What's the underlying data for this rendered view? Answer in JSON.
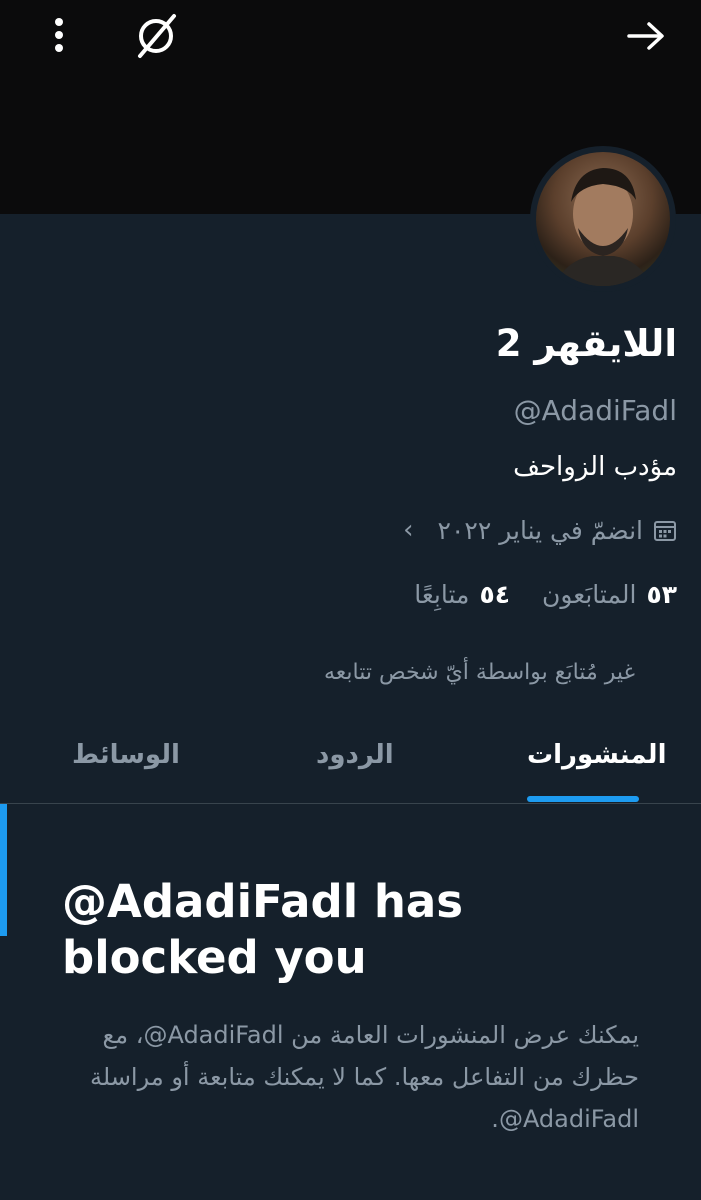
{
  "topbar": {
    "menu_icon": "kebab-vertical-icon",
    "logo_icon": "slashed-circle-icon",
    "nav_icon": "arrow-right-icon"
  },
  "profile": {
    "display_name": "اللايقهر 2",
    "handle": "@AdadiFadl",
    "bio": "مؤدب الزواحف",
    "joined": "انضمّ في يناير ٢٠٢٢",
    "joined_icon": "calendar-icon",
    "followers_count": "٥٣",
    "followers_label": "المتابَعون",
    "following_count": "٥٤",
    "following_label": "متابِعًا",
    "not_followed_note": "غير مُتابَع بواسطة أيّ شخص تتابعه"
  },
  "tabs": [
    {
      "label": "المنشورات",
      "active": true
    },
    {
      "label": "الردود",
      "active": false
    },
    {
      "label": "الوسائط",
      "active": false
    }
  ],
  "blocked": {
    "title": "@AdadiFadl has blocked you",
    "description": "يمكنك عرض المنشورات العامة من ‎@AdadiFadl‏، مع حظرك من التفاعل معها. كما لا يمكنك متابعة أو مراسلة ‎@AdadiFadl‏."
  },
  "colors": {
    "background": "#15202b",
    "banner": "#0b0b0c",
    "accent": "#1d9bf0",
    "secondary_text": "#8b98a5"
  }
}
